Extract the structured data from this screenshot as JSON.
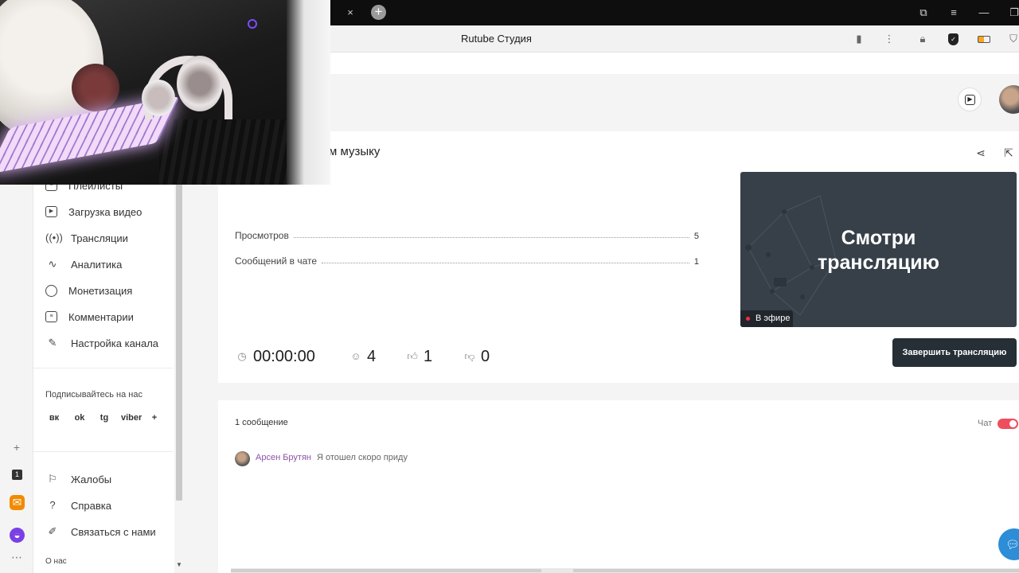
{
  "browser": {
    "tab_close": "×",
    "tab_new": "+",
    "window_controls": [
      "⧉",
      "≡",
      "—",
      "❐"
    ],
    "address_title": "Rutube Студия",
    "toolbar_icons": [
      "bookmark-icon",
      "more-icon",
      "lock-icon",
      "shield-icon",
      "battery-icon",
      "extension-icon"
    ]
  },
  "sidebar": {
    "items": [
      {
        "label": "Плейлисты",
        "icon": "playlist-icon"
      },
      {
        "label": "Загрузка видео",
        "icon": "upload-video-icon"
      },
      {
        "label": "Трансляции",
        "icon": "broadcast-icon"
      },
      {
        "label": "Аналитика",
        "icon": "analytics-icon"
      },
      {
        "label": "Монетизация",
        "icon": "monetization-icon"
      },
      {
        "label": "Комментарии",
        "icon": "comments-icon"
      },
      {
        "label": "Настройка канала",
        "icon": "channel-settings-icon"
      }
    ],
    "subscribe_title": "Подписывайтесь на нас",
    "socials": [
      "вк",
      "ok",
      "tg",
      "viber",
      "+"
    ],
    "bottom_items": [
      {
        "label": "Жалобы",
        "icon": "flag-icon"
      },
      {
        "label": "Справка",
        "icon": "help-icon"
      },
      {
        "label": "Связаться с нами",
        "icon": "edit-icon"
      }
    ],
    "about": "О нас"
  },
  "stream": {
    "title_fragment": "м музыку",
    "stats": [
      {
        "label": "Просмотров",
        "value": "5"
      },
      {
        "label": "Сообщений в чате",
        "value": "1"
      }
    ],
    "counters": {
      "duration": "00:00:00",
      "viewers": "4",
      "likes": "1",
      "dislikes": "0"
    },
    "preview_text_line1": "Смотри",
    "preview_text_line2": "трансляцию",
    "live_badge": "В эфире",
    "end_button": "Завершить трансляцию"
  },
  "chat": {
    "message_count": "1 сообщение",
    "toggle_label": "Чат",
    "toggle_on": true,
    "messages": [
      {
        "author": "Арсен Брутян",
        "text": "Я отошел скоро приду"
      }
    ]
  },
  "rail": {
    "badge": "1"
  },
  "colors": {
    "accent": "#ef4e5e",
    "dark_button": "#262e36",
    "preview_bg": "#374049",
    "author": "#8d52a8"
  }
}
